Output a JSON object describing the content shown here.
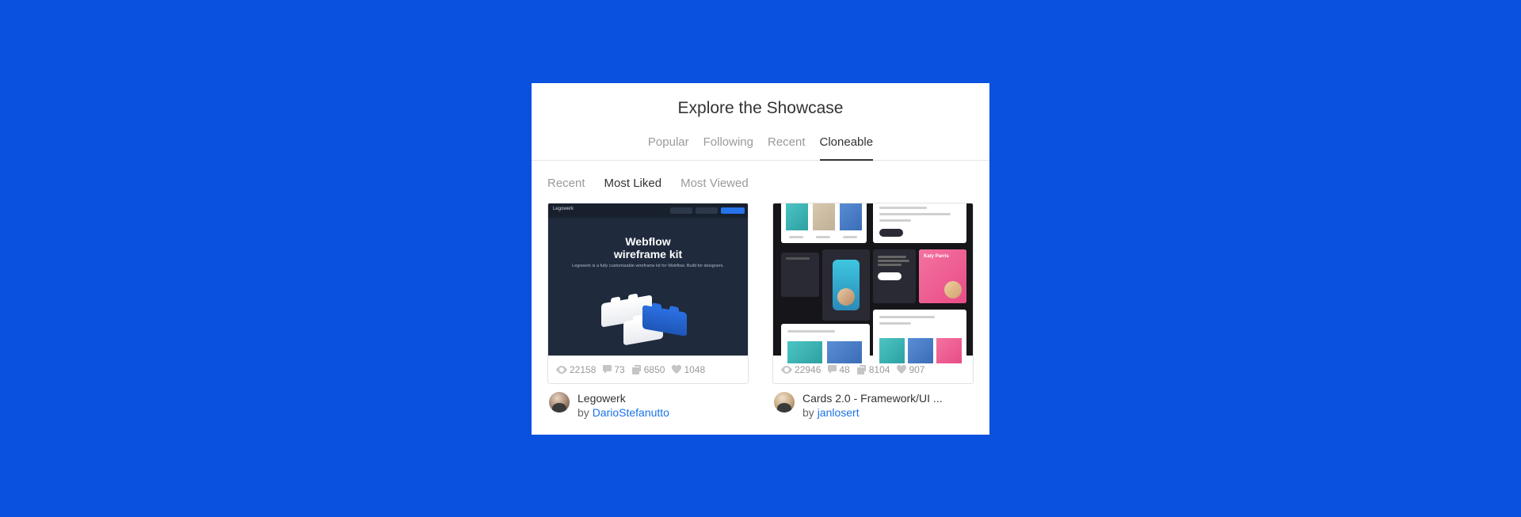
{
  "header": {
    "title": "Explore the Showcase",
    "primary_tabs": [
      "Popular",
      "Following",
      "Recent",
      "Cloneable"
    ],
    "primary_active": 3,
    "secondary_tabs": [
      "Recent",
      "Most Liked",
      "Most Viewed"
    ],
    "secondary_active": 1
  },
  "cards": [
    {
      "title": "Legowerk",
      "author": "DarioStefanutto",
      "by": "by ",
      "preview": {
        "brand": "Legowerk",
        "headline_l1": "Webflow",
        "headline_l2": "wireframe kit",
        "sub": "Legowerk is a fully customizable wireframe kit for Webflow. Build for designers."
      },
      "stats": {
        "views": "22158",
        "comments": "73",
        "clones": "6850",
        "likes": "1048"
      }
    },
    {
      "title": "Cards 2.0 - Framework/UI ...",
      "author": "janlosert",
      "by": "by ",
      "stats": {
        "views": "22946",
        "comments": "48",
        "clones": "8104",
        "likes": "907"
      }
    }
  ],
  "icons": {
    "eye": "eye-icon",
    "comment": "comment-icon",
    "clone": "clone-icon",
    "heart": "heart-icon"
  }
}
